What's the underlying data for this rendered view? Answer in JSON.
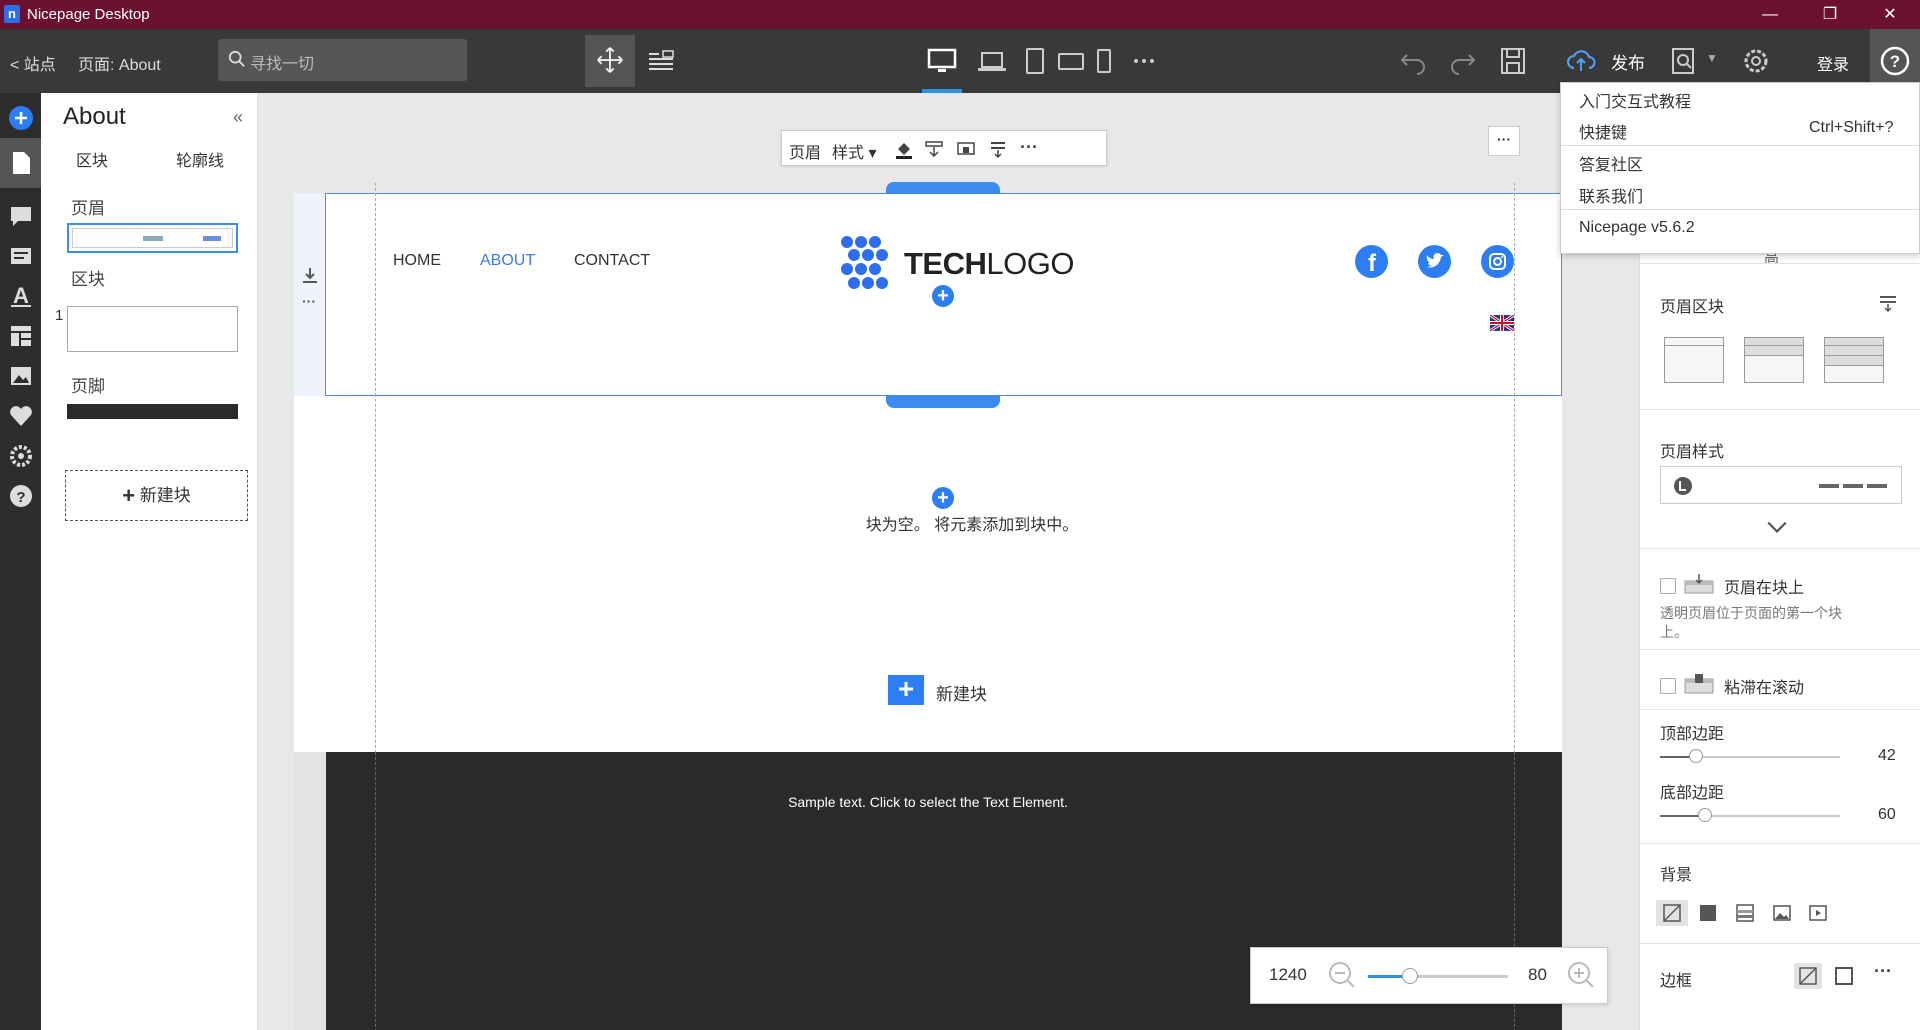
{
  "window": {
    "title": "Nicepage Desktop",
    "minimize": "—",
    "maximize": "❐",
    "close": "✕"
  },
  "toolbar": {
    "back_label": "< 站点",
    "page_label": "页面: About",
    "search_placeholder": "寻找一切",
    "publish_label": "发布",
    "login_label": "登录"
  },
  "left_panel": {
    "title": "About",
    "collapse": "«",
    "tabs": [
      "区块",
      "轮廓线"
    ],
    "sections": {
      "header": "页眉",
      "blocks": "区块",
      "block_index": "1",
      "footer": "页脚"
    },
    "new_block": "新建块"
  },
  "canvas": {
    "float_toolbar": {
      "header": "页眉",
      "style": "样式 ▾"
    },
    "nav": [
      "HOME",
      "ABOUT",
      "CONTACT"
    ],
    "logo": {
      "bold": "TECH",
      "light": "LOGO"
    },
    "empty_message": "块为空。 将元素添加到块中。",
    "new_block": "新建块",
    "footer_text": "Sample text. Click to select the Text Element."
  },
  "zoom": {
    "width_value": "1240",
    "zoom_value": "80",
    "fraction": 0.3
  },
  "right_panel": {
    "header_blocks_label": "页眉区块",
    "header_style_label": "页眉样式",
    "header_on_block_label": "页眉在块上",
    "header_on_block_desc1": "透明页眉位于页面的第一个块",
    "header_on_block_desc2": "上。",
    "sticky_label": "粘滞在滚动",
    "top_margin_label": "顶部边距",
    "top_margin_value": "42",
    "top_margin_fraction": 0.2,
    "bottom_margin_label": "底部边距",
    "bottom_margin_value": "60",
    "bottom_margin_fraction": 0.25,
    "background_label": "背景",
    "border_label": "边框",
    "partial_hidden": "高"
  },
  "help_menu": {
    "items": [
      "入门交互式教程",
      "快捷键",
      "答复社区",
      "联系我们",
      "Nicepage v5.6.2"
    ],
    "shortcut": "Ctrl+Shift+?"
  },
  "colors": {
    "accent": "#2d7df5",
    "titlebar": "#6b1030",
    "toolbar": "#393939"
  }
}
